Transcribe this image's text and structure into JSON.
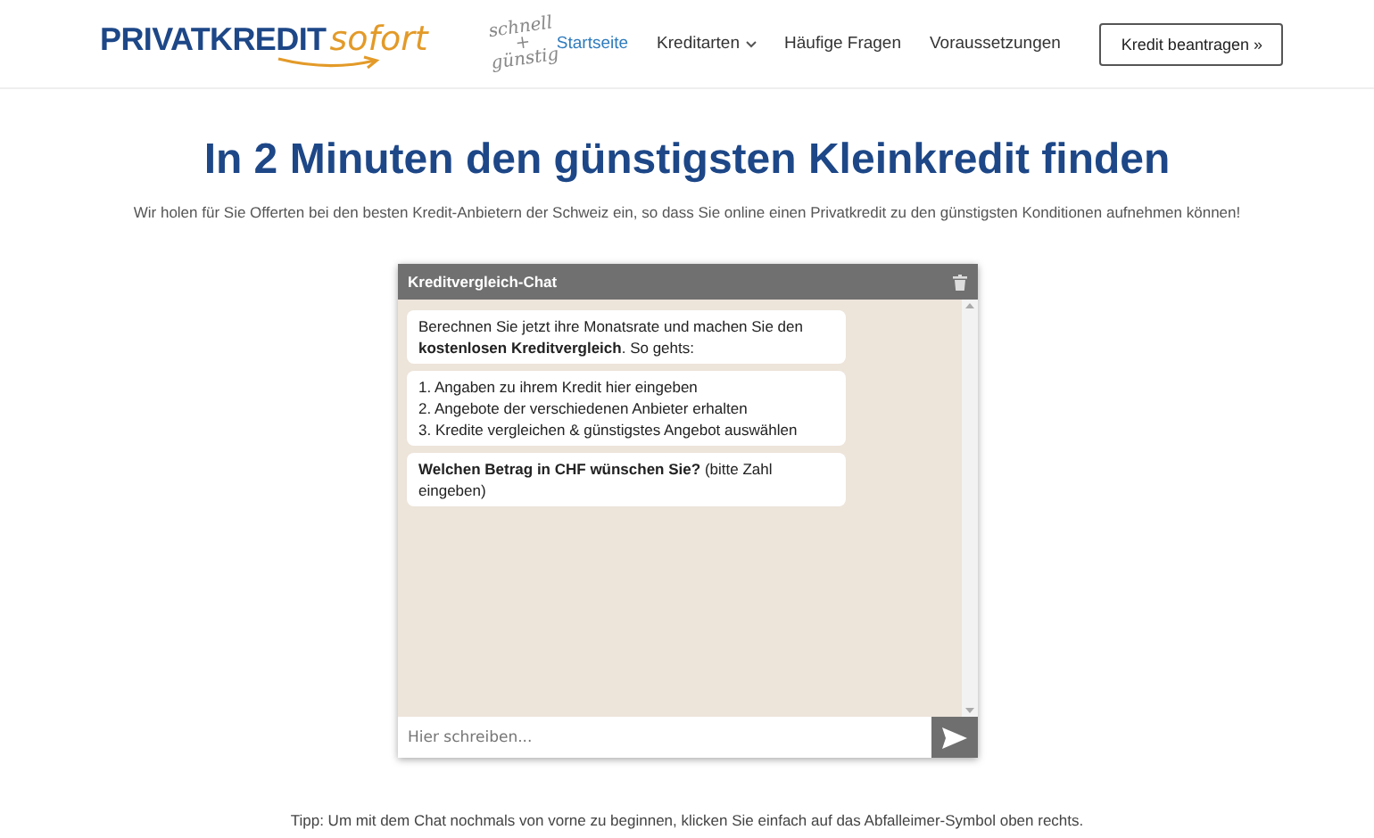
{
  "logo": {
    "brand": "PRIVATKREDIT",
    "accent": "sofort"
  },
  "tagline": [
    "schnell",
    "+",
    "günstig"
  ],
  "nav": [
    {
      "label": "Startseite",
      "selected": true,
      "dropdown": false
    },
    {
      "label": "Kreditarten",
      "selected": false,
      "dropdown": true
    },
    {
      "label": "Häufige Fragen",
      "selected": false,
      "dropdown": false
    },
    {
      "label": "Voraussetzungen",
      "selected": false,
      "dropdown": false
    }
  ],
  "cta_button": "Kredit beantragen »",
  "headline": "In 2 Minuten den günstigsten Kleinkredit finden",
  "intro": "Wir holen für Sie Offerten bei den besten Kredit-Anbietern der Schweiz ein, so dass Sie online einen Privatkredit zu den günstigsten Konditionen aufnehmen können!",
  "chat": {
    "title": "Kreditvergleich-Chat",
    "messages": [
      {
        "lines": [
          "Berechnen Sie jetzt ihre Monatsrate und machen Sie den **kostenlosen Kreditvergleich**. So gehts:"
        ]
      },
      {
        "lines": [
          "1. Angaben zu ihrem Kredit hier eingeben",
          "2. Angebote der verschiedenen Anbieter erhalten",
          "3. Kredite vergleichen & günstigstes Angebot auswählen"
        ]
      },
      {
        "lines": [
          "**Welchen Betrag in CHF wünschen Sie?** (bitte Zahl eingeben)"
        ]
      }
    ],
    "input": {
      "placeholder": "Hier schreiben..."
    }
  },
  "tip": "Tipp: Um mit dem Chat nochmals von vorne zu beginnen, klicken Sie einfach auf das Abfalleimer-Symbol oben rechts."
}
